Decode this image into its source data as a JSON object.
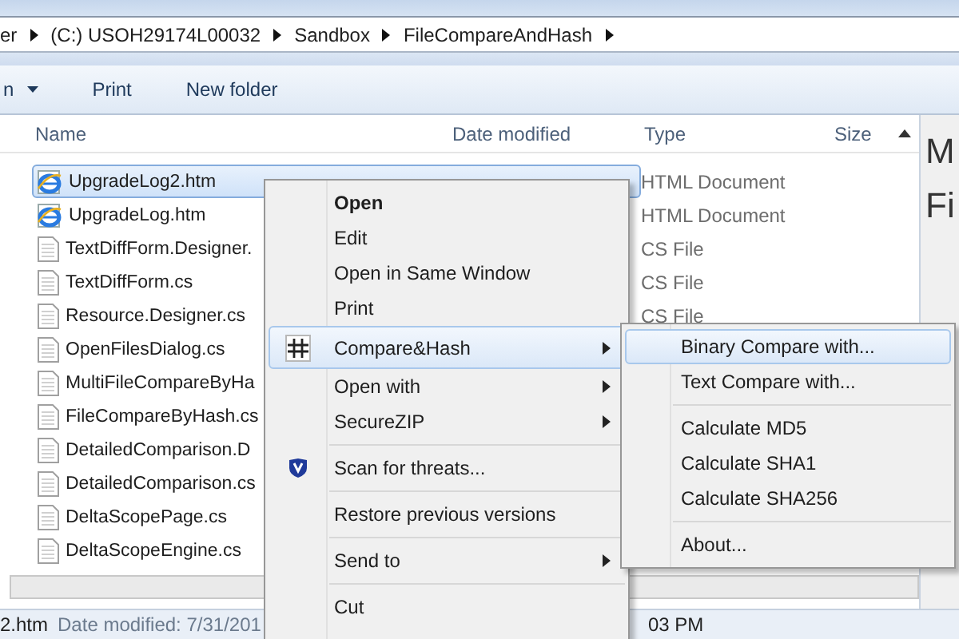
{
  "address_bar": {
    "crumbs": [
      "er",
      "(C:) USOH29174L00032",
      "Sandbox",
      "FileCompareAndHash"
    ]
  },
  "toolbar": {
    "items": [
      {
        "label": "n",
        "dropdown": true
      },
      {
        "label": "Print",
        "dropdown": false
      },
      {
        "label": "New folder",
        "dropdown": false
      }
    ]
  },
  "table": {
    "columns": [
      "Name",
      "Date modified",
      "Type",
      "Size"
    ],
    "rows": [
      {
        "name": "UpgradeLog2.htm",
        "kind": "web",
        "type": "HTML Document",
        "selected": true
      },
      {
        "name": "UpgradeLog.htm",
        "kind": "web",
        "type": "HTML Document",
        "selected": false
      },
      {
        "name": "TextDiffForm.Designer.",
        "kind": "text",
        "type": "CS File",
        "selected": false
      },
      {
        "name": "TextDiffForm.cs",
        "kind": "text",
        "type": "CS File",
        "selected": false
      },
      {
        "name": "Resource.Designer.cs",
        "kind": "text",
        "type": "CS File",
        "selected": false
      },
      {
        "name": "OpenFilesDialog.cs",
        "kind": "text",
        "selected": false
      },
      {
        "name": "MultiFileCompareByHa",
        "kind": "text",
        "selected": false
      },
      {
        "name": "FileCompareByHash.cs",
        "kind": "text",
        "selected": false
      },
      {
        "name": "DetailedComparison.D",
        "kind": "text",
        "selected": false
      },
      {
        "name": "DetailedComparison.cs",
        "kind": "text",
        "selected": false
      },
      {
        "name": "DeltaScopePage.cs",
        "kind": "text",
        "selected": false
      },
      {
        "name": "DeltaScopeEngine.cs",
        "kind": "text",
        "selected": false
      }
    ]
  },
  "preview_pane": {
    "lines": [
      "M",
      "Fi"
    ]
  },
  "status_bar": {
    "file": "2.htm",
    "date_label": "Date modified: 7/31/201",
    "time": "03 PM"
  },
  "context_menu": {
    "items": [
      {
        "kind": "item",
        "label": "Open",
        "bold": true,
        "submenu": false,
        "selected": false
      },
      {
        "kind": "item",
        "label": "Edit",
        "bold": false,
        "submenu": false,
        "selected": false
      },
      {
        "kind": "item",
        "label": "Open in Same Window",
        "bold": false,
        "submenu": false,
        "selected": false
      },
      {
        "kind": "item",
        "label": "Print",
        "bold": false,
        "submenu": false,
        "selected": false
      },
      {
        "kind": "hash_item",
        "label": "Compare&Hash",
        "bold": false,
        "submenu": true,
        "selected": true
      },
      {
        "kind": "item",
        "label": "Open with",
        "bold": false,
        "submenu": true,
        "selected": false
      },
      {
        "kind": "item",
        "label": "SecureZIP",
        "bold": false,
        "submenu": true,
        "selected": false
      },
      {
        "kind": "separator"
      },
      {
        "kind": "shield_item",
        "label": "Scan for threats...",
        "bold": false,
        "submenu": false,
        "selected": false
      },
      {
        "kind": "separator"
      },
      {
        "kind": "item",
        "label": "Restore previous versions",
        "bold": false,
        "submenu": false,
        "selected": false
      },
      {
        "kind": "separator"
      },
      {
        "kind": "item",
        "label": "Send to",
        "bold": false,
        "submenu": true,
        "selected": false
      },
      {
        "kind": "separator"
      },
      {
        "kind": "item",
        "label": "Cut",
        "bold": false,
        "submenu": false,
        "selected": false
      }
    ]
  },
  "submenu": {
    "items": [
      {
        "kind": "item",
        "label": "Binary Compare with...",
        "selected": true
      },
      {
        "kind": "item",
        "label": "Text Compare with...",
        "selected": false
      },
      {
        "kind": "separator"
      },
      {
        "kind": "item",
        "label": "Calculate MD5",
        "selected": false
      },
      {
        "kind": "item",
        "label": "Calculate SHA1",
        "selected": false
      },
      {
        "kind": "item",
        "label": "Calculate SHA256",
        "selected": false
      },
      {
        "kind": "separator"
      },
      {
        "kind": "item",
        "label": "About...",
        "selected": false
      }
    ]
  }
}
